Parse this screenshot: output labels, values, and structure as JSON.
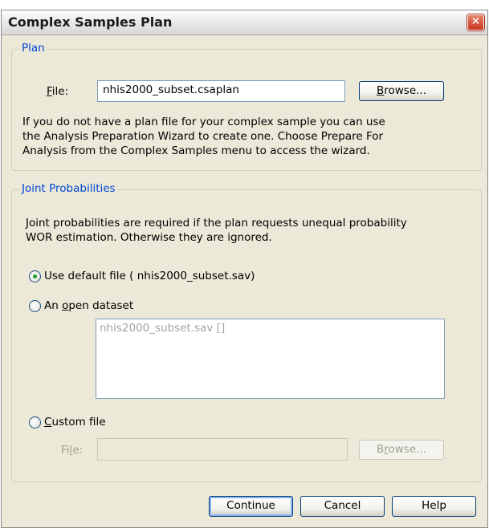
{
  "dialog": {
    "title": "Complex Samples Plan",
    "close_glyph": "✕"
  },
  "plan": {
    "legend": "Plan",
    "file_label_prefix": "",
    "file_label_u": "F",
    "file_label_rest": "ile:",
    "file_value": "nhis2000_subset.csaplan",
    "browse_u": "B",
    "browse_rest": "rowse...",
    "info_lines": [
      "If you do not have a plan file for your complex sample you can use",
      "the Analysis Preparation Wizard to create one. Choose Prepare For",
      "Analysis from the Complex Samples menu to access the wizard."
    ]
  },
  "joint": {
    "legend": "Joint Probabilities",
    "info_lines": [
      "Joint probabilities are required if the plan requests unequal probability",
      "WOR estimation. Otherwise they are ignored."
    ],
    "opt_default": "Use default file ( nhis2000_subset.sav)",
    "opt_open_pre": "An ",
    "opt_open_u": "o",
    "opt_open_post": "pen dataset",
    "dataset_item": "nhis2000_subset.sav []",
    "opt_custom_u": "C",
    "opt_custom_rest": "ustom file",
    "custom_file_pre": "Fi",
    "custom_file_u": "l",
    "custom_file_post": "e:",
    "custom_file_value": "",
    "browse2_pre": "B",
    "browse2_u": "r",
    "browse2_post": "owse..."
  },
  "footer": {
    "continue": "Continue",
    "cancel": "Cancel",
    "help": "Help"
  }
}
